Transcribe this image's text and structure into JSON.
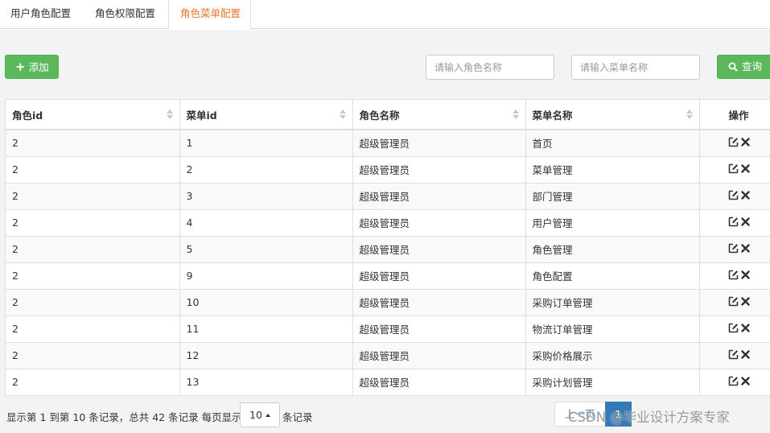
{
  "tabs": [
    {
      "label": "用户角色配置"
    },
    {
      "label": "角色权限配置"
    },
    {
      "label": "角色菜单配置"
    }
  ],
  "toolbar": {
    "add_label": "添加",
    "role_name_placeholder": "请输入角色名称",
    "menu_name_placeholder": "请输入菜单名称",
    "query_label": "查询"
  },
  "table": {
    "columns": [
      "角色id",
      "菜单id",
      "角色名称",
      "菜单名称",
      "操作"
    ],
    "rows": [
      {
        "role_id": "2",
        "menu_id": "1",
        "role_name": "超级管理员",
        "menu_name": "首页"
      },
      {
        "role_id": "2",
        "menu_id": "2",
        "role_name": "超级管理员",
        "menu_name": "菜单管理"
      },
      {
        "role_id": "2",
        "menu_id": "3",
        "role_name": "超级管理员",
        "menu_name": "部门管理"
      },
      {
        "role_id": "2",
        "menu_id": "4",
        "role_name": "超级管理员",
        "menu_name": "用户管理"
      },
      {
        "role_id": "2",
        "menu_id": "5",
        "role_name": "超级管理员",
        "menu_name": "角色管理"
      },
      {
        "role_id": "2",
        "menu_id": "9",
        "role_name": "超级管理员",
        "menu_name": "角色配置"
      },
      {
        "role_id": "2",
        "menu_id": "10",
        "role_name": "超级管理员",
        "menu_name": "采购订单管理"
      },
      {
        "role_id": "2",
        "menu_id": "11",
        "role_name": "超级管理员",
        "menu_name": "物流订单管理"
      },
      {
        "role_id": "2",
        "menu_id": "12",
        "role_name": "超级管理员",
        "menu_name": "采购价格展示"
      },
      {
        "role_id": "2",
        "menu_id": "13",
        "role_name": "超级管理员",
        "menu_name": "采购计划管理"
      }
    ]
  },
  "footer": {
    "info": "显示第 1 到第 10 条记录，总共 42 条记录 每页显示",
    "page_size": "10",
    "records_label": "条记录"
  },
  "pagination": {
    "prev_label": "上一页",
    "current_page": "1"
  },
  "watermark": "CSDN @毕业设计方案专家",
  "colors": {
    "accent_tab": "#e8762e",
    "button_green": "#5cb85c",
    "pagination_active": "#337ab7"
  }
}
